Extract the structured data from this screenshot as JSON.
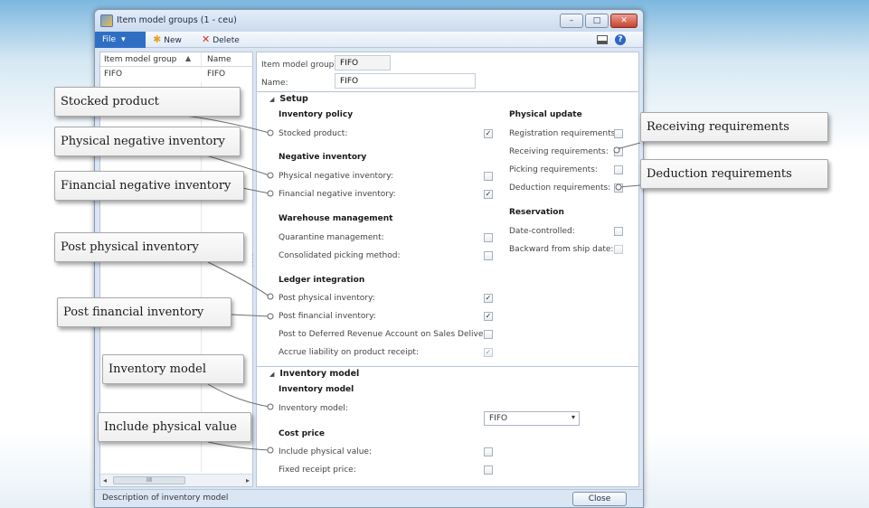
{
  "window": {
    "title": "Item model groups (1 - ceu)",
    "min_glyph": "–",
    "max_glyph": "□",
    "close_glyph": "✕"
  },
  "toolbar": {
    "file_label": "File",
    "file_caret": "▾",
    "new_label": "New",
    "new_icon": "✱",
    "delete_label": "Delete",
    "delete_icon": "✕",
    "help_glyph": "?"
  },
  "list": {
    "col_group": "Item model group",
    "col_name": "Name",
    "sort_glyph": "▲",
    "rows": [
      {
        "group": "FIFO",
        "name": "FIFO"
      }
    ],
    "scroll_left": "◂",
    "scroll_right": "▸",
    "scroll_thumb": "III"
  },
  "header": {
    "group_label": "Item model group:",
    "group_value": "FIFO",
    "name_label": "Name:",
    "name_value": "FIFO"
  },
  "setup": {
    "title": "Setup",
    "collapse_glyph": "◢",
    "inventory_policy": {
      "title": "Inventory policy",
      "stocked_product": {
        "label": "Stocked product:",
        "checked": true
      }
    },
    "negative_inventory": {
      "title": "Negative inventory",
      "physical": {
        "label": "Physical negative inventory:",
        "checked": false
      },
      "financial": {
        "label": "Financial negative inventory:",
        "checked": true
      }
    },
    "warehouse_management": {
      "title": "Warehouse management",
      "quarantine": {
        "label": "Quarantine management:",
        "checked": false
      },
      "consolidated": {
        "label": "Consolidated picking method:",
        "checked": false
      }
    },
    "ledger_integration": {
      "title": "Ledger integration",
      "post_physical": {
        "label": "Post physical inventory:",
        "checked": true
      },
      "post_financial": {
        "label": "Post financial inventory:",
        "checked": true
      },
      "post_deferred": {
        "label": "Post to Deferred Revenue Account on Sales Delivery:",
        "checked": false
      },
      "accrue": {
        "label": "Accrue liability on product receipt:",
        "checked": true
      }
    },
    "physical_update": {
      "title": "Physical update",
      "registration": {
        "label": "Registration requirements:",
        "checked": false
      },
      "receiving": {
        "label": "Receiving requirements:",
        "checked": false
      },
      "picking": {
        "label": "Picking requirements:",
        "checked": false
      },
      "deduction": {
        "label": "Deduction requirements:",
        "checked": false
      }
    },
    "reservation": {
      "title": "Reservation",
      "date_controlled": {
        "label": "Date-controlled:",
        "checked": false
      },
      "backward": {
        "label": "Backward from ship date:",
        "checked": false
      }
    }
  },
  "inventory_model_section": {
    "title": "Inventory model",
    "group_title": "Inventory model",
    "model_label": "Inventory model:",
    "model_value": "FIFO",
    "dropdown_glyph": "▾",
    "cost_price_title": "Cost price",
    "include_physical": {
      "label": "Include physical value:",
      "checked": false
    },
    "fixed_receipt": {
      "label": "Fixed receipt price:",
      "checked": false
    }
  },
  "status": {
    "text": "Description of inventory model",
    "close_label": "Close"
  },
  "checkmark": "✓",
  "callouts": {
    "stocked_product": "Stocked product",
    "physical_negative": "Physical negative inventory",
    "financial_negative": "Financial negative inventory",
    "post_physical": "Post physical inventory",
    "post_financial": "Post financial inventory",
    "inventory_model": "Inventory model",
    "include_physical": "Include physical value",
    "receiving": "Receiving requirements",
    "deduction": "Deduction requirements"
  }
}
